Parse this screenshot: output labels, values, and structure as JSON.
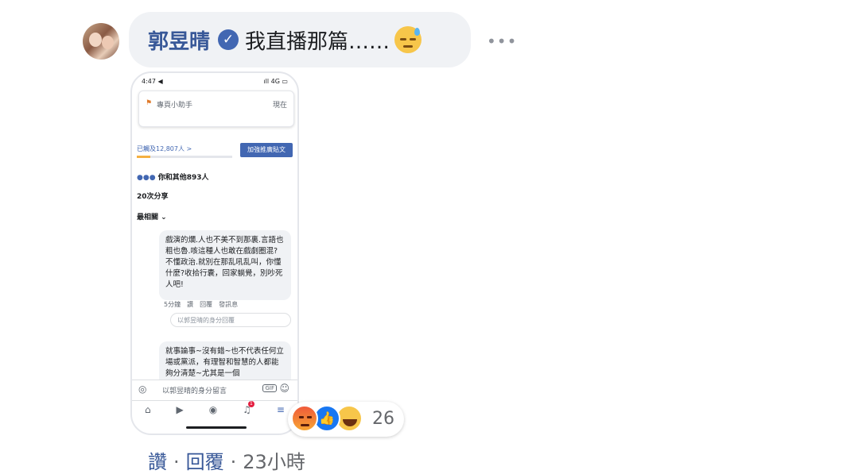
{
  "comment": {
    "author": "郭昱晴",
    "text": "我直播那篇……",
    "emoji_icon": "sweat-face-icon",
    "more_icon": "•••"
  },
  "screenshot": {
    "status_time": "4:47 ◀",
    "status_right": "ıll 4G ▭",
    "page_name": "專頁小助手",
    "now_label": "現在",
    "reach_text": "已觸及12,807人 >",
    "reach_progress": 0.14,
    "boost_label": "加強推廣貼文",
    "reactions_text": "你和其他893人",
    "shares_text": "20次分享",
    "sort_label": "最相關 ⌄",
    "comment1_text": "戲演的爛.人也不美不到那裏.言語也粗也魯.咳這種人也敢在戲劇圈混?不懂政治.就別在那乱吼乱叫，你懂什麼?收拾行囊，回家躺覺，別吵死人吧!",
    "comment1_actions": "5分鐘　讚　回覆　發訊息",
    "reply_placeholder": "以郭昱晴的身分回覆",
    "comment2_text": "就事論事~沒有錯~也不代表任何立場或黨派，有理智和智慧的人都能夠分清楚~尤其是一個",
    "input_placeholder": "以郭昱晴的身分留言",
    "gif_label": "GIF",
    "notification_badge": "1"
  },
  "reactions": {
    "count": "26"
  },
  "footer": {
    "like": "讚",
    "reply": "回覆",
    "separator": "·",
    "time": "23小時"
  }
}
